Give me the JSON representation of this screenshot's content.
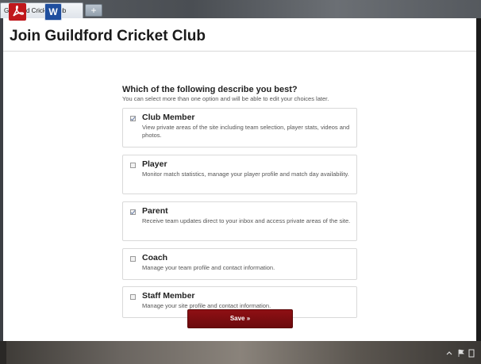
{
  "browser": {
    "tab_title": "Guildford Cricket Club",
    "new_tab_label": "+"
  },
  "page": {
    "title": "Join Guildford Cricket Club",
    "question": "Which of the following describe you best?",
    "subtext": "You can select more than one option and will be able to edit your choices later.",
    "options": [
      {
        "title": "Club Member",
        "description": "View private areas of the site including team selection, player stats, videos and photos.",
        "checked": true
      },
      {
        "title": "Player",
        "description": "Monitor match statistics, manage your player profile and match day availability.",
        "checked": false
      },
      {
        "title": "Parent",
        "description": "Receive team updates direct to your inbox and access private areas of the site.",
        "checked": true
      },
      {
        "title": "Coach",
        "description": "Manage your team profile and contact information.",
        "checked": false
      },
      {
        "title": "Staff Member",
        "description": "Manage your site profile and contact information.",
        "checked": false
      }
    ],
    "save_label": "Save »"
  },
  "taskbar": {
    "icons": [
      "pdf-icon",
      "word-icon"
    ],
    "tray": [
      "chevron-up-icon",
      "flag-icon",
      "battery-icon"
    ]
  },
  "colors": {
    "accent": "#7d0d10",
    "title_text": "#1a1a1a"
  }
}
